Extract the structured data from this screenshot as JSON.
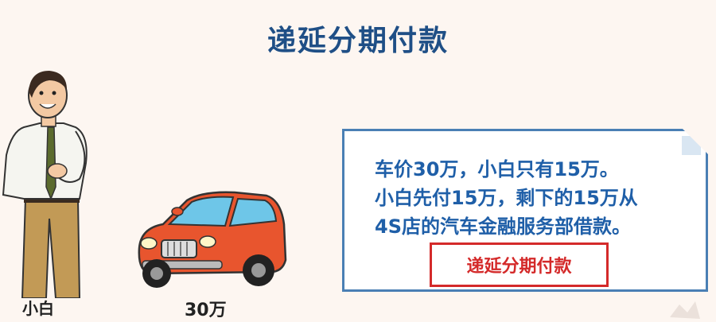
{
  "title": "递延分期付款",
  "person": {
    "label": "小白"
  },
  "car": {
    "label": "30万",
    "color": "#e8552e"
  },
  "info": {
    "lines": [
      "车价30万，小白只有15万。",
      "小白先付15万，剩下的15万从",
      "4S店的汽车金融服务部借款。"
    ]
  },
  "stamp": {
    "label": "递延分期付款"
  },
  "colors": {
    "title": "#1f4f86",
    "info_text": "#1f5fa8",
    "stamp": "#d42a2a"
  }
}
